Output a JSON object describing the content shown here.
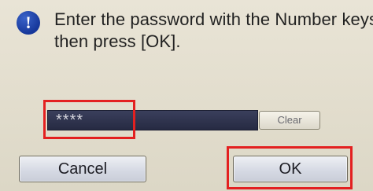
{
  "dialog": {
    "icon": "info-icon",
    "icon_glyph": "!",
    "message_line1": "Enter the password with the Number keys,",
    "message_line2": "then press [OK]."
  },
  "password": {
    "value": "****"
  },
  "buttons": {
    "clear_label": "Clear",
    "cancel_label": "Cancel",
    "ok_label": "OK"
  },
  "colors": {
    "highlight": "#e32020",
    "icon_blue": "#1e45b0",
    "password_bar": "#2f334d"
  }
}
